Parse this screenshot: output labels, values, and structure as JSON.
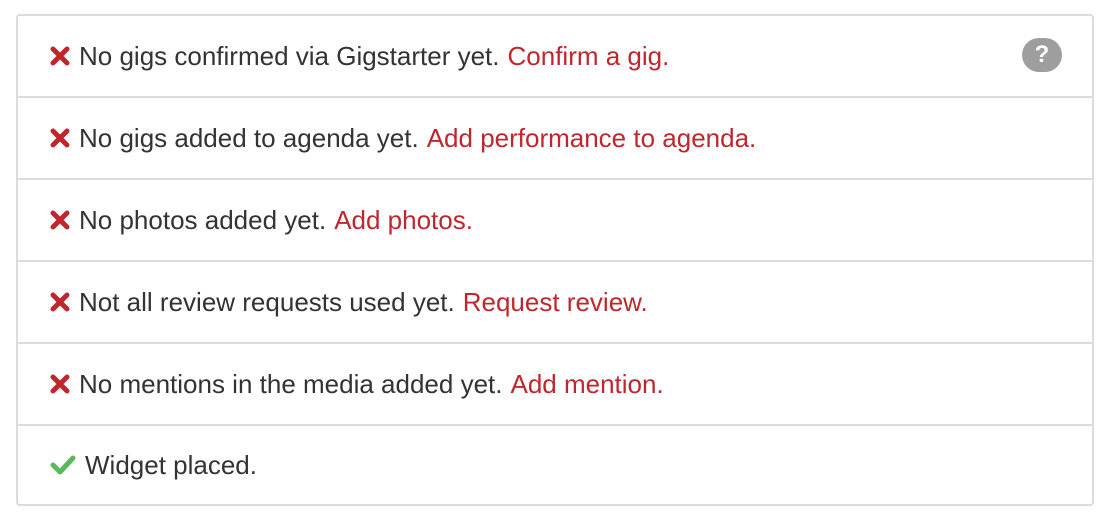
{
  "checklist": {
    "help_glyph": "?",
    "items": [
      {
        "status": "fail",
        "icon": "x-icon",
        "message": "No gigs confirmed via Gigstarter yet.",
        "action": "Confirm a gig."
      },
      {
        "status": "fail",
        "icon": "x-icon",
        "message": "No gigs added to agenda yet.",
        "action": "Add performance to agenda."
      },
      {
        "status": "fail",
        "icon": "x-icon",
        "message": "No photos added yet.",
        "action": "Add photos."
      },
      {
        "status": "fail",
        "icon": "x-icon",
        "message": "Not all review requests used yet.",
        "action": "Request review."
      },
      {
        "status": "fail",
        "icon": "x-icon",
        "message": "No mentions in the media added yet.",
        "action": "Add mention."
      },
      {
        "status": "ok",
        "icon": "check-icon",
        "message": "Widget placed.",
        "action": ""
      }
    ]
  },
  "colors": {
    "error": "#c0272d",
    "success": "#5cb85c",
    "border": "#dcdcdc",
    "help_bg": "#9e9e9e"
  }
}
